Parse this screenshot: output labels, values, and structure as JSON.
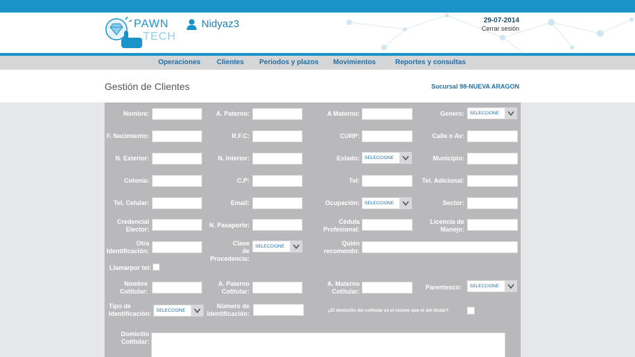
{
  "brand": {
    "line1": "PAWN",
    "line2": "TECH"
  },
  "user": {
    "name": "Nidyaz3"
  },
  "header": {
    "date": "29-07-2014",
    "logout": "Cerrar sesión"
  },
  "nav": {
    "items": [
      "Operaciones",
      "Clientes",
      "Periodos y plazos",
      "Movimientos",
      "Reportes y consultas"
    ]
  },
  "page": {
    "title": "Gestión de Clientes",
    "branch": "Sucursal 98-NUEVA ARAGON"
  },
  "colors": {
    "accent": "#1a93c8",
    "panel": "#b9b9bb",
    "nav_text": "#1f6fa6"
  },
  "form": {
    "select_placeholder": "SELECCIONE",
    "labels": {
      "nombre": "Nombre:",
      "a_paterno": "A. Paterno:",
      "a_materno": "A Materno:",
      "genero": "Genero:",
      "f_nacimiento": "F. Nacimiento:",
      "rfc": "R.F.C:",
      "curp": "CURP:",
      "calle": "Calle o Av:",
      "n_exterior": "N. Exterior:",
      "n_interior": "N. Interior:",
      "estado": "Estado:",
      "municipio": "Municipio:",
      "colonia": "Colonia:",
      "cp": "C.P:",
      "tel": "Tel:",
      "tel_adicional": "Tel. Adicional:",
      "tel_celular": "Tel. Celular:",
      "email": "Email:",
      "ocupacion": "Ocupación:",
      "sector": "Sector:",
      "credencial_1": "Credencial",
      "credencial_2": "Elector:",
      "n_pasaporte": "N. Pasaporte:",
      "cedula_1": "Cédula",
      "cedula_2": "Profesional:",
      "licencia_1": "Licencia de",
      "licencia_2": "Manejo:",
      "otra_1": "Otra",
      "otra_2": "Identificación:",
      "clave_1": "Clave",
      "clave_2": "de Procedencia:",
      "quien_1": "Quién",
      "quien_2": "recomendo:",
      "llamar": "Llamarpor tel:",
      "nombre_cot_1": "Nombre",
      "nombre_cot_2": "Cotitular:",
      "ap_cot_1": "A. Paterno",
      "ap_cot_2": "Cotitular:",
      "am_cot_1": "A. Materno",
      "am_cot_2": "Cotitular:",
      "parentesco": "Parentesco:",
      "tipo_id_1": "Tipo de",
      "tipo_id_2": "Identificación:",
      "num_id_1": "Número de",
      "num_id_2": "Identificación:",
      "domicilio_q": "¿El domicilio del cotitular es el mismo que el del titular?",
      "domicilio_cot_1": "Domicilio",
      "domicilio_cot_2": "Cotitular:"
    }
  }
}
